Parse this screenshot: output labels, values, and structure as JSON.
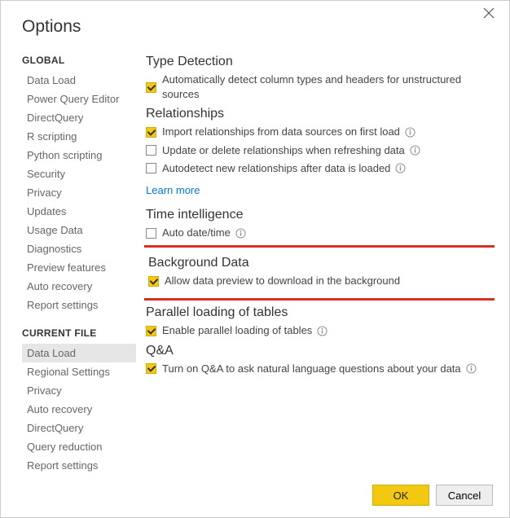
{
  "dialog": {
    "title": "Options",
    "close_label": "Close"
  },
  "nav": {
    "global": {
      "label": "GLOBAL",
      "items": [
        "Data Load",
        "Power Query Editor",
        "DirectQuery",
        "R scripting",
        "Python scripting",
        "Security",
        "Privacy",
        "Updates",
        "Usage Data",
        "Diagnostics",
        "Preview features",
        "Auto recovery",
        "Report settings"
      ]
    },
    "current": {
      "label": "CURRENT FILE",
      "items": [
        "Data Load",
        "Regional Settings",
        "Privacy",
        "Auto recovery",
        "DirectQuery",
        "Query reduction",
        "Report settings"
      ],
      "selected": "Data Load"
    }
  },
  "sections": {
    "type_detection": {
      "heading": "Type Detection",
      "opt1": {
        "label": "Automatically detect column types and headers for unstructured sources",
        "checked": true,
        "info": false
      }
    },
    "relationships": {
      "heading": "Relationships",
      "opt1": {
        "label": "Import relationships from data sources on first load",
        "checked": true,
        "info": true
      },
      "opt2": {
        "label": "Update or delete relationships when refreshing data",
        "checked": false,
        "info": true
      },
      "opt3": {
        "label": "Autodetect new relationships after data is loaded",
        "checked": false,
        "info": true
      },
      "learn_more": "Learn more"
    },
    "time_intelligence": {
      "heading": "Time intelligence",
      "opt1": {
        "label": "Auto date/time",
        "checked": false,
        "info": true
      }
    },
    "background_data": {
      "heading": "Background Data",
      "opt1": {
        "label": "Allow data preview to download in the background",
        "checked": true,
        "info": false
      }
    },
    "parallel_loading": {
      "heading": "Parallel loading of tables",
      "opt1": {
        "label": "Enable parallel loading of tables",
        "checked": true,
        "info": true
      }
    },
    "qna": {
      "heading": "Q&A",
      "opt1": {
        "label": "Turn on Q&A to ask natural language questions about your data",
        "checked": true,
        "info": true
      }
    }
  },
  "footer": {
    "ok": "OK",
    "cancel": "Cancel"
  }
}
